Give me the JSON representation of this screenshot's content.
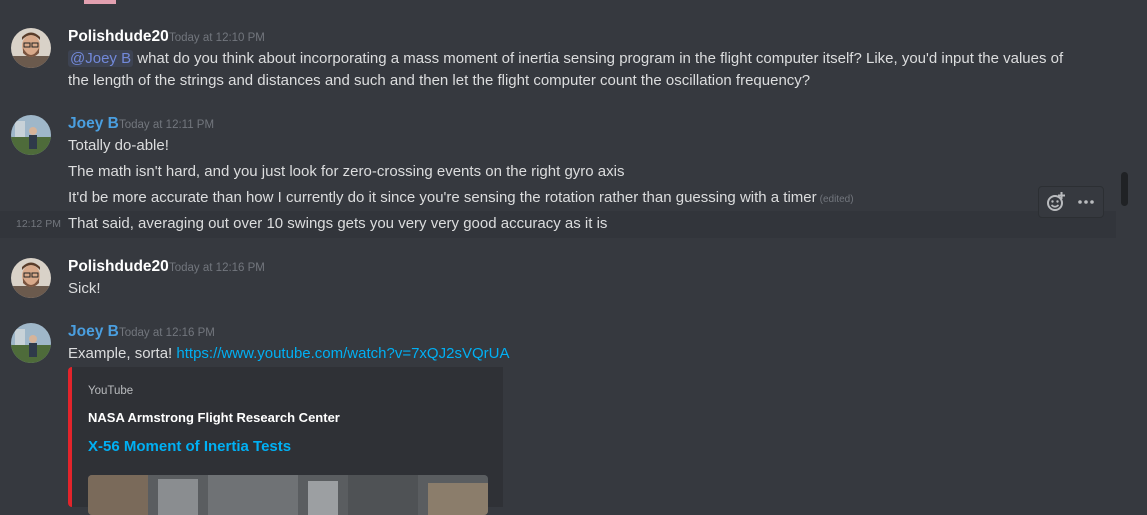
{
  "colors": {
    "background": "#36393f",
    "mention": "#7289da",
    "link": "#00b0f4",
    "joey": "#4a9fe0",
    "embed_border": "#e3242b"
  },
  "messages": [
    {
      "author": "Polishdude20",
      "timestamp": "Today at 12:10 PM",
      "mention": "@Joey B",
      "line1_rest": " what do you think about incorporating a mass moment of inertia sensing program in the flight computer itself? Like, you'd input the values of",
      "line2": "the length of the strings and distances and such and then let the flight computer count the oscillation frequency?"
    },
    {
      "author": "Joey B",
      "timestamp": "Today at 12:11 PM",
      "lines": [
        "Totally do-able!",
        "The math isn't hard, and you just look for zero-crossing events on the right gyro axis",
        "It'd be more accurate than how I currently do it since you're sensing the rotation rather than guessing with a timer"
      ],
      "edited": "(edited)",
      "hover_time": "12:12 PM",
      "hover_line": "That said, averaging out over 10 swings gets you very very good accuracy as it is"
    },
    {
      "author": "Polishdude20",
      "timestamp": "Today at 12:16 PM",
      "lines": [
        "Sick!"
      ]
    },
    {
      "author": "Joey B",
      "timestamp": "Today at 12:16 PM",
      "text": "Example, sorta! ",
      "link": "https://www.youtube.com/watch?v=7xQJ2sVQrUA",
      "embed": {
        "provider": "YouTube",
        "author": "NASA Armstrong Flight Research Center",
        "title": "X-56 Moment of Inertia Tests"
      }
    }
  ],
  "toolbar": {
    "reaction_icon": "add-reaction-icon",
    "more_icon": "more-options-icon"
  }
}
